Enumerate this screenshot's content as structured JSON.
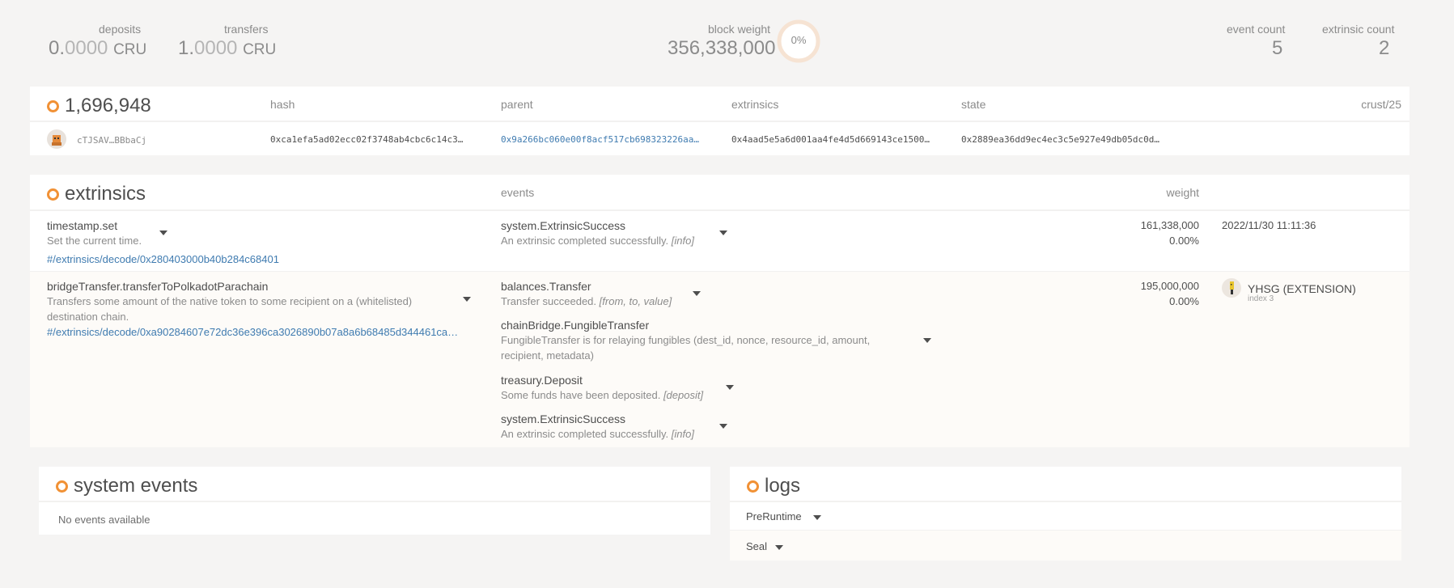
{
  "summary": {
    "deposits": {
      "label": "deposits",
      "int": "0.",
      "frac": "0000",
      "unit": "CRU"
    },
    "transfers": {
      "label": "transfers",
      "int": "1.",
      "frac": "0000",
      "unit": "CRU"
    },
    "block_weight": {
      "label": "block weight",
      "value": "356,338,000",
      "percent": "0%",
      "fraction": 0.0
    },
    "event_count": {
      "label": "event count",
      "value": "5"
    },
    "extrinsic_count": {
      "label": "extrinsic count",
      "value": "2"
    }
  },
  "block": {
    "number": "1,696,948",
    "headers": {
      "hash": "hash",
      "parent": "parent",
      "extrinsics": "extrinsics",
      "state": "state",
      "runtime": "crust/25"
    },
    "author": "cTJSAV…BBbaCj",
    "hash": "0xca1efa5ad02ecc02f3748ab4cbc6c14c3…",
    "parent": "0x9a266bc060e00f8acf517cb698323226aa…",
    "extrinsics_root": "0x4aad5e5a6d001aa4fe4d5d669143ce1500…",
    "state_root": "0x2889ea36dd9ec4ec3c5e927e49db05dc0d…"
  },
  "extrinsics": {
    "title": "extrinsics",
    "headers": {
      "events": "events",
      "weight": "weight"
    },
    "rows": [
      {
        "method": "timestamp.set",
        "description": "Set the current time.",
        "link": "#/extrinsics/decode/0x280403000b40b284c68401",
        "events": [
          {
            "name": "system.ExtrinsicSuccess",
            "desc": "An extrinsic completed successfully.",
            "tag": "[info]"
          }
        ],
        "weight": "161,338,000",
        "weight_pct": "0.00%",
        "time": "2022/11/30 11:11:36"
      },
      {
        "method": "bridgeTransfer.transferToPolkadotParachain",
        "description_line1": "Transfers some amount of the native token to some recipient on a (whitelisted)",
        "description_line2": "destination chain.",
        "link": "#/extrinsics/decode/0xa90284607e72dc36e396ca3026890b07a8a6b68485d344461ca…",
        "events": [
          {
            "name": "balances.Transfer",
            "desc": "Transfer succeeded.",
            "tag": "[from, to, value]"
          },
          {
            "name": "chainBridge.FungibleTransfer",
            "desc_line1": "FungibleTransfer is for relaying fungibles (dest_id, nonce, resource_id, amount,",
            "desc_line2": "recipient, metadata)"
          },
          {
            "name": "treasury.Deposit",
            "desc": "Some funds have been deposited.",
            "tag": "[deposit]"
          },
          {
            "name": "system.ExtrinsicSuccess",
            "desc": "An extrinsic completed successfully.",
            "tag": "[info]"
          }
        ],
        "weight": "195,000,000",
        "weight_pct": "0.00%",
        "signer": "YHSG (EXTENSION)",
        "signer_index": "index 3"
      }
    ]
  },
  "system_events": {
    "title": "system events",
    "empty": "No events available"
  },
  "logs": {
    "title": "logs",
    "items": [
      "PreRuntime",
      "Seal"
    ]
  }
}
